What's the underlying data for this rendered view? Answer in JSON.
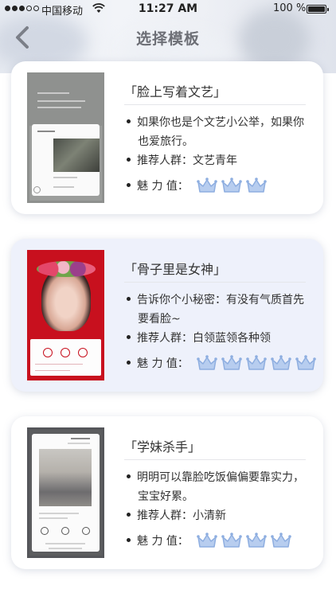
{
  "status_bar": {
    "carrier": "中国移动",
    "time": "11:27 AM",
    "battery_percent": "100 %",
    "battery_level": 1.0,
    "signal_bars_filled": 3,
    "signal_bars_total": 5
  },
  "nav": {
    "title": "选择模板",
    "back_icon": "chevron-left-icon"
  },
  "colors": {
    "crown": "#b7cdef",
    "crown_stroke": "#8eaee0",
    "card2_bg": "#eef1fb"
  },
  "templates": [
    {
      "title": "「脸上写着文艺」",
      "desc_line1": "如果你也是个文艺小公举，如果你",
      "desc_line2": "也爱旅行。",
      "audience_label": "推荐人群：",
      "audience": "文艺青年",
      "rating_label": "魅 力 值：",
      "rating": 3
    },
    {
      "title": "「骨子里是女神」",
      "desc_line1": "告诉你个小秘密：有没有气质首先",
      "desc_line2": "要看脸~",
      "audience_label": "推荐人群：",
      "audience": "白领蓝领各种领",
      "rating_label": "魅 力 值：",
      "rating": 5
    },
    {
      "title": "「学妹杀手」",
      "desc_line1": "明明可以靠脸吃饭偏偏要靠实力，",
      "desc_line2": "宝宝好累。",
      "audience_label": "推荐人群：",
      "audience": "小清新",
      "rating_label": "魅 力 值：",
      "rating": 4
    }
  ]
}
